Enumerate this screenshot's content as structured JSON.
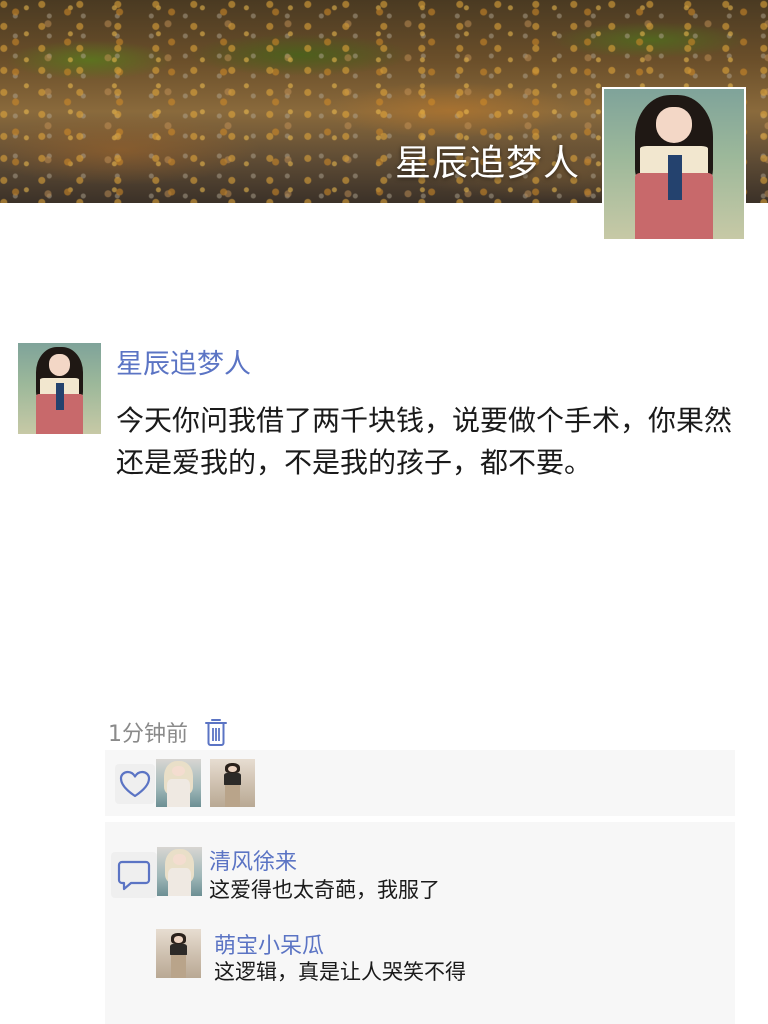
{
  "profile": {
    "cover_name": "星辰追梦人",
    "avatar_icon": "user-avatar-hanbok"
  },
  "post": {
    "author": "星辰追梦人",
    "text": "今天你问我借了两千块钱，说要做个手术，你果然还是爱我的，不是我的孩子，都不要。",
    "time": "1分钟前",
    "delete_icon": "trash-icon"
  },
  "likes": {
    "icon": "heart-icon",
    "avatars": [
      "user-avatar-blonde",
      "user-avatar-street"
    ]
  },
  "comments": [
    {
      "name": "清风徐来",
      "text": "这爱得也太奇葩，我服了",
      "avatar": "user-avatar-blonde"
    },
    {
      "name": "萌宝小呆瓜",
      "text": "这逻辑，真是让人哭笑不得",
      "avatar": "user-avatar-street"
    }
  ],
  "colors": {
    "link": "#5b74c4",
    "panel_bg": "#f7f7f7",
    "icon": "#5b74c4"
  }
}
